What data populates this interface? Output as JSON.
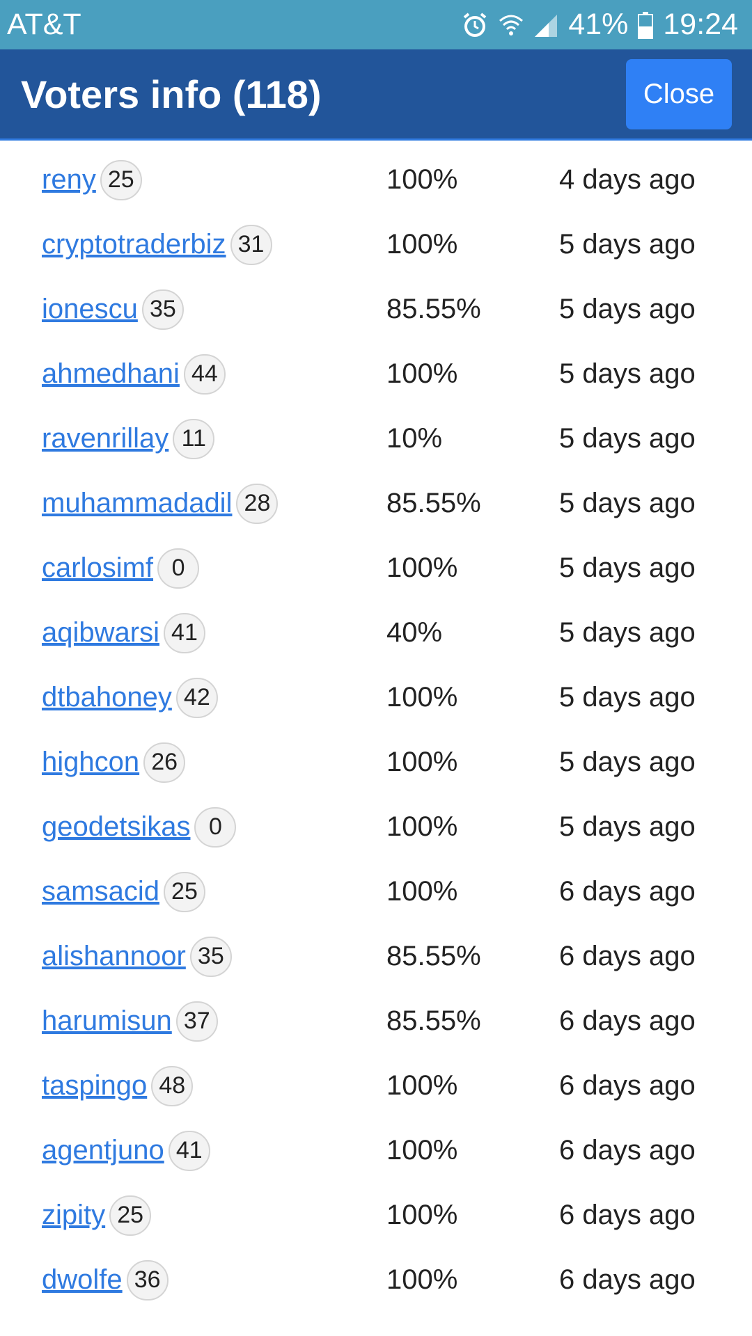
{
  "status_bar": {
    "carrier": "AT&T",
    "battery": "41%",
    "time": "19:24",
    "icons": [
      "alarm-icon",
      "wifi-icon",
      "signal-icon",
      "battery-icon"
    ]
  },
  "header": {
    "title": "Voters info (118)",
    "close_label": "Close"
  },
  "voters": [
    {
      "name": "reny",
      "rep": "25",
      "percent": "100%",
      "time": "4 days ago"
    },
    {
      "name": "cryptotraderbiz",
      "rep": "31",
      "percent": "100%",
      "time": "5 days ago"
    },
    {
      "name": "ionescu",
      "rep": "35",
      "percent": "85.55%",
      "time": "5 days ago"
    },
    {
      "name": "ahmedhani",
      "rep": "44",
      "percent": "100%",
      "time": "5 days ago"
    },
    {
      "name": "ravenrillay",
      "rep": "11",
      "percent": "10%",
      "time": "5 days ago"
    },
    {
      "name": "muhammadadil",
      "rep": "28",
      "percent": "85.55%",
      "time": "5 days ago"
    },
    {
      "name": "carlosimf",
      "rep": "0",
      "percent": "100%",
      "time": "5 days ago"
    },
    {
      "name": "aqibwarsi",
      "rep": "41",
      "percent": "40%",
      "time": "5 days ago"
    },
    {
      "name": "dtbahoney",
      "rep": "42",
      "percent": "100%",
      "time": "5 days ago"
    },
    {
      "name": "highcon",
      "rep": "26",
      "percent": "100%",
      "time": "5 days ago"
    },
    {
      "name": "geodetsikas",
      "rep": "0",
      "percent": "100%",
      "time": "5 days ago"
    },
    {
      "name": "samsacid",
      "rep": "25",
      "percent": "100%",
      "time": "6 days ago"
    },
    {
      "name": "alishannoor",
      "rep": "35",
      "percent": "85.55%",
      "time": "6 days ago"
    },
    {
      "name": "harumisun",
      "rep": "37",
      "percent": "85.55%",
      "time": "6 days ago"
    },
    {
      "name": "taspingo",
      "rep": "48",
      "percent": "100%",
      "time": "6 days ago"
    },
    {
      "name": "agentjuno",
      "rep": "41",
      "percent": "100%",
      "time": "6 days ago"
    },
    {
      "name": "zipity",
      "rep": "25",
      "percent": "100%",
      "time": "6 days ago"
    },
    {
      "name": "dwolfe",
      "rep": "36",
      "percent": "100%",
      "time": "6 days ago"
    }
  ]
}
